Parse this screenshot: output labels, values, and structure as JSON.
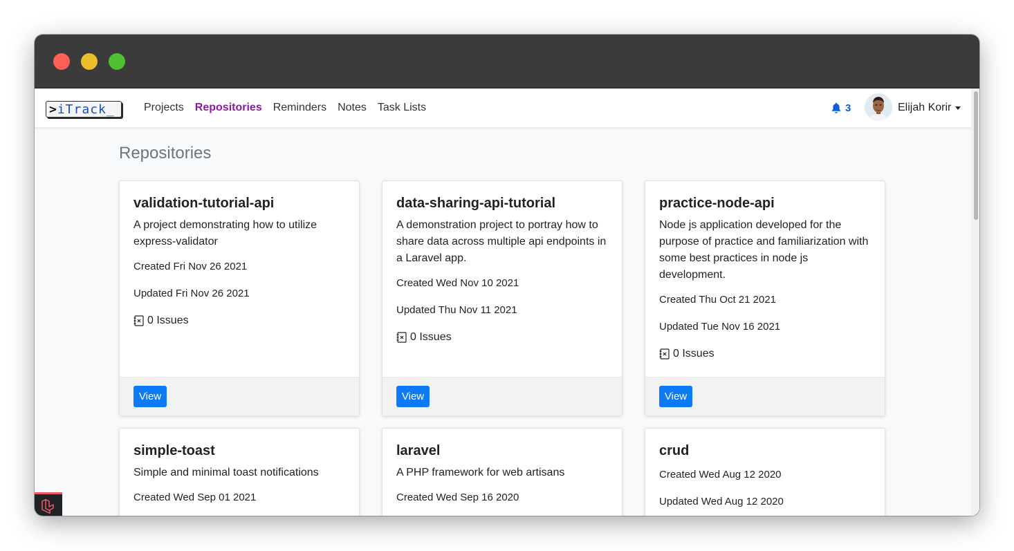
{
  "brand": {
    "text": "iTrack_",
    "prompt": ">"
  },
  "nav": {
    "links": [
      {
        "label": "Projects"
      },
      {
        "label": "Repositories"
      },
      {
        "label": "Reminders"
      },
      {
        "label": "Notes"
      },
      {
        "label": "Task Lists"
      }
    ],
    "active": "Repositories",
    "notifications_count": "3",
    "user_name": "Elijah Korir"
  },
  "page": {
    "title": "Repositories"
  },
  "colors": {
    "accent": "#0d7bf5",
    "active_nav": "#8a1a9e",
    "bell": "#0b5ed7"
  },
  "repos": [
    {
      "name": "validation-tutorial-api",
      "description": "A project demonstrating how to utilize express-validator",
      "created": "Created Fri Nov 26 2021",
      "updated": "Updated Fri Nov 26 2021",
      "issues": "0 Issues",
      "button": "View"
    },
    {
      "name": "data-sharing-api-tutorial",
      "description": "A demonstration project to portray how to share data across multiple api endpoints in a Laravel app.",
      "created": "Created Wed Nov 10 2021",
      "updated": "Updated Thu Nov 11 2021",
      "issues": "0 Issues",
      "button": "View"
    },
    {
      "name": "practice-node-api",
      "description": "Node js application developed for the purpose of practice and familiarization with some best practices in node js development.",
      "created": "Created Thu Oct 21 2021",
      "updated": "Updated Tue Nov 16 2021",
      "issues": "0 Issues",
      "button": "View"
    },
    {
      "name": "simple-toast",
      "description": "Simple and minimal toast notifications",
      "created": "Created Wed Sep 01 2021"
    },
    {
      "name": "laravel",
      "description": "A PHP framework for web artisans",
      "created": "Created Wed Sep 16 2020"
    },
    {
      "name": "crud",
      "created": "Created Wed Aug 12 2020",
      "updated": "Updated Wed Aug 12 2020"
    }
  ]
}
